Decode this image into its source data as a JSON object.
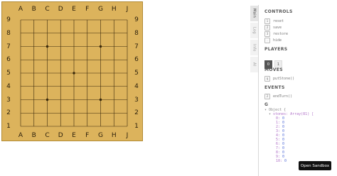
{
  "board": {
    "columns": [
      "A",
      "B",
      "C",
      "D",
      "E",
      "F",
      "G",
      "H",
      "J"
    ],
    "rows": [
      "9",
      "8",
      "7",
      "6",
      "5",
      "4",
      "3",
      "2",
      "1"
    ],
    "hoshi": [
      [
        "C",
        "7"
      ],
      [
        "G",
        "7"
      ],
      [
        "E",
        "5"
      ],
      [
        "C",
        "3"
      ],
      [
        "G",
        "3"
      ]
    ],
    "colors": {
      "wood": "#dcb35c",
      "line": "#3b2a0c"
    }
  },
  "tabs": [
    "Main",
    "Log",
    "Info",
    "AI"
  ],
  "panel": {
    "controls_title": "CONTROLS",
    "controls": [
      {
        "key": "1",
        "label": "reset"
      },
      {
        "key": "2",
        "label": "save"
      },
      {
        "key": "3",
        "label": "restore"
      },
      {
        "key": ".",
        "label": "hide"
      }
    ],
    "players_title": "PLAYERS",
    "players": [
      "0",
      "1"
    ],
    "active_player": "0",
    "moves_title": "MOVES",
    "moves": [
      {
        "key": "q",
        "label": "putStone()"
      }
    ],
    "events_title": "EVENTS",
    "events": [
      {
        "key": "2",
        "label": "endTurn()"
      }
    ],
    "g_title": "G",
    "tree": {
      "root": "Object {",
      "stones": "stones: Array(81) [",
      "items": [
        {
          "k": "0:",
          "v": "0"
        },
        {
          "k": "1:",
          "v": "0"
        },
        {
          "k": "2:",
          "v": "0"
        },
        {
          "k": "3:",
          "v": "0"
        },
        {
          "k": "4:",
          "v": "0"
        },
        {
          "k": "5:",
          "v": "0"
        },
        {
          "k": "6:",
          "v": "0"
        },
        {
          "k": "7:",
          "v": "0"
        },
        {
          "k": "8:",
          "v": "0"
        },
        {
          "k": "9:",
          "v": "0"
        },
        {
          "k": "10:",
          "v": "0"
        }
      ]
    }
  },
  "sandbox_button": "Open Sandbox"
}
